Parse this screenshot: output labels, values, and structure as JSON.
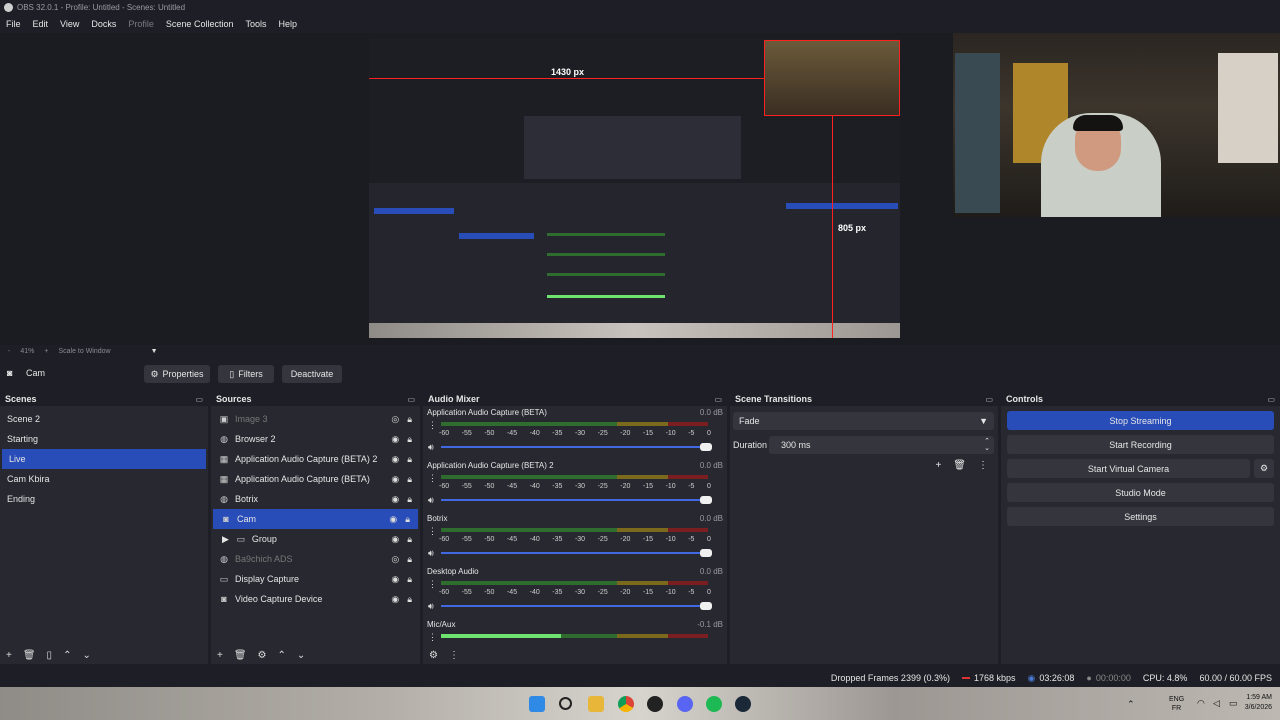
{
  "window": {
    "title": "OBS 32.0.1 - Profile: Untitled - Scenes: Untitled"
  },
  "menu": {
    "file": "File",
    "edit": "Edit",
    "view": "View",
    "docks": "Docks",
    "profile": "Profile",
    "scene_collection": "Scene Collection",
    "tools": "Tools",
    "help": "Help"
  },
  "preview": {
    "measure_h": "1430 px",
    "measure_v": "805 px"
  },
  "zoom": {
    "minus": "-",
    "level": "41%",
    "plus": "+",
    "scale_mode": "Scale to Window"
  },
  "source_bar": {
    "selected_source": "Cam",
    "properties": "Properties",
    "filters": "Filters",
    "deactivate": "Deactivate"
  },
  "scenes": {
    "title": "Scenes",
    "items": [
      {
        "label": "Scene 2"
      },
      {
        "label": "Starting"
      },
      {
        "label": "Live",
        "active": true
      },
      {
        "label": "Cam Kbira"
      },
      {
        "label": "Ending"
      }
    ]
  },
  "sources": {
    "title": "Sources",
    "items": [
      {
        "label": "Image 3"
      },
      {
        "label": "Browser 2"
      },
      {
        "label": "Application Audio Capture (BETA) 2"
      },
      {
        "label": "Application Audio Capture (BETA)"
      },
      {
        "label": "Botrix"
      },
      {
        "label": "Cam"
      },
      {
        "label": "Group"
      },
      {
        "label": "Ba9chich ADS"
      },
      {
        "label": "Display Capture"
      },
      {
        "label": "Video Capture Device"
      }
    ]
  },
  "mixer": {
    "title": "Audio Mixer",
    "scale": [
      "-60",
      "-55",
      "-50",
      "-45",
      "-40",
      "-35",
      "-30",
      "-25",
      "-20",
      "-15",
      "-10",
      "-5",
      "0"
    ],
    "channels": [
      {
        "name": "Application Audio Capture (BETA)",
        "db": "0.0 dB",
        "level": 0
      },
      {
        "name": "Application Audio Capture (BETA) 2",
        "db": "0.0 dB",
        "level": 0
      },
      {
        "name": "Botrix",
        "db": "0.0 dB",
        "level": 0
      },
      {
        "name": "Desktop Audio",
        "db": "0.0 dB",
        "level": 0
      },
      {
        "name": "Mic/Aux",
        "db": "-0.1 dB",
        "level": 0.45
      }
    ]
  },
  "transitions": {
    "title": "Scene Transitions",
    "selected": "Fade",
    "duration_label": "Duration",
    "duration_value": "300 ms"
  },
  "controls": {
    "title": "Controls",
    "stop_streaming": "Stop Streaming",
    "start_recording": "Start Recording",
    "start_virtual_camera": "Start Virtual Camera",
    "studio_mode": "Studio Mode",
    "settings": "Settings"
  },
  "status": {
    "dropped_frames": "Dropped Frames 2399 (0.3%)",
    "bitrate": "1768 kbps",
    "stream_time": "03:26:08",
    "record_time": "00:00:00",
    "cpu": "CPU: 4.8%",
    "fps": "60.00 / 60.00 FPS"
  },
  "taskbar": {
    "lang": "ENG",
    "region": "FR",
    "time": "1:59 AM",
    "date": "3/6/2026"
  },
  "colors": {
    "accent": "#284cb8",
    "dock_bg": "#272830",
    "window_bg": "#1e1f26"
  }
}
